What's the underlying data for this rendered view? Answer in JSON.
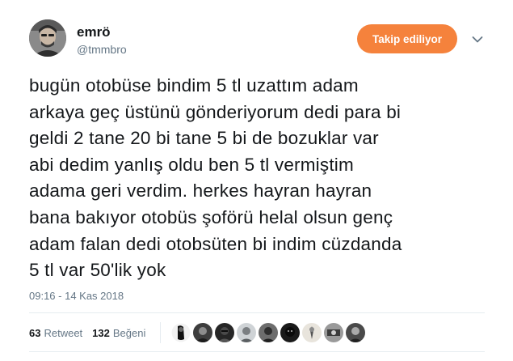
{
  "user": {
    "name": "emrö",
    "handle": "@tmmbro",
    "follow_label": "Takip ediliyor"
  },
  "tweet": {
    "text": "bugün otobüse bindim 5 tl uzattım adam\narkaya geç üstünü gönderiyorum dedi para bi\ngeldi 2 tane 20 bi tane 5 bi de bozuklar var\nabi dedim yanlış oldu ben 5 tl vermiştim\nadama geri verdim. herkes hayran hayran\nbana bakıyor otobüs şoförü helal olsun genç\nadam falan dedi otobsüten bi indim cüzdanda\n5 tl var 50'lik yok",
    "timestamp": "09:16 - 14 Kas 2018"
  },
  "stats": {
    "retweets_count": "63",
    "retweets_label": "Retweet",
    "likes_count": "132",
    "likes_label": "Beğeni"
  },
  "likers": [
    "avatar",
    "avatar",
    "avatar",
    "avatar",
    "avatar",
    "avatar",
    "avatar",
    "avatar",
    "avatar"
  ],
  "colors": {
    "follow_button": "#f5823c",
    "secondary_text": "#657786",
    "primary_text": "#14171a",
    "divider": "#e6ecf0"
  },
  "icons": {
    "more": "chevron-down-icon"
  }
}
